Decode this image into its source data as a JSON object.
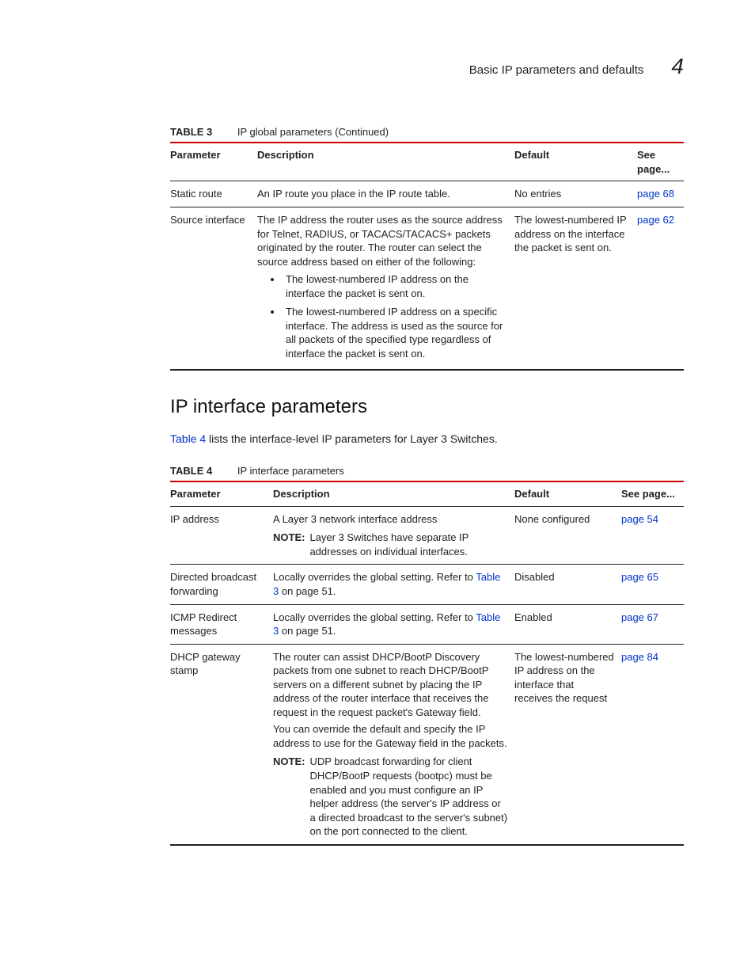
{
  "header": {
    "title": "Basic IP parameters and defaults",
    "chapter": "4"
  },
  "table3": {
    "caption_label": "TABLE 3",
    "caption_title": "IP global parameters (Continued)",
    "headers": {
      "parameter": "Parameter",
      "description": "Description",
      "default": "Default",
      "see": "See page..."
    },
    "rows": [
      {
        "parameter": "Static route",
        "description": "An IP route you place in the IP route table.",
        "default": "No entries",
        "see_link": "page 68"
      },
      {
        "parameter": "Source interface",
        "description_intro": "The IP address the router uses as the source address for Telnet, RADIUS, or TACACS/TACACS+ packets originated by the router. The router can select the source address based on either of the following:",
        "bullets": [
          "The lowest-numbered IP address on the interface the packet is sent on.",
          "The lowest-numbered IP address on a specific interface. The address is used as the source for all packets of the specified type regardless of interface the packet is sent on."
        ],
        "default": "The lowest-numbered IP address on the interface the packet is sent on.",
        "see_link": "page 62"
      }
    ]
  },
  "section2": {
    "heading": "IP interface parameters",
    "intro_link": "Table 4",
    "intro_rest": " lists the interface-level IP parameters for Layer 3 Switches."
  },
  "table4": {
    "caption_label": "TABLE 4",
    "caption_title": "IP interface parameters",
    "headers": {
      "parameter": "Parameter",
      "description": "Description",
      "default": "Default",
      "see": "See page..."
    },
    "rows": [
      {
        "parameter": "IP address",
        "description": "A Layer 3 network interface address",
        "note_label": "NOTE:",
        "note_body": "Layer 3 Switches have separate IP addresses on individual interfaces.",
        "default": "None configured",
        "see_link": "page 54"
      },
      {
        "parameter": "Directed broadcast forwarding",
        "desc_pre": "Locally overrides the global setting. Refer to ",
        "desc_link": "Table 3",
        "desc_post": " on page 51.",
        "default": "Disabled",
        "see_link": "page 65"
      },
      {
        "parameter": "ICMP Redirect messages",
        "desc_pre": "Locally overrides the global setting. Refer to ",
        "desc_link": "Table 3",
        "desc_post": " on page 51.",
        "default": "Enabled",
        "see_link": "page 67"
      },
      {
        "parameter": "DHCP gateway stamp",
        "desc_para1": "The router can assist DHCP/BootP Discovery packets from one subnet to reach DHCP/BootP servers on a different subnet by placing the IP address of the router interface that receives the request in the request packet's Gateway field.",
        "desc_para2": "You can override the default and specify the IP address to use for the Gateway field in the packets.",
        "note_label": "NOTE:",
        "note_body": "UDP broadcast forwarding for client DHCP/BootP requests (bootpc) must be enabled and you must configure an IP helper address (the server's IP address or a directed broadcast to the server's subnet) on the port connected to the client.",
        "default": "The lowest-numbered IP address on the interface that receives the request",
        "see_link": "page 84"
      }
    ]
  }
}
